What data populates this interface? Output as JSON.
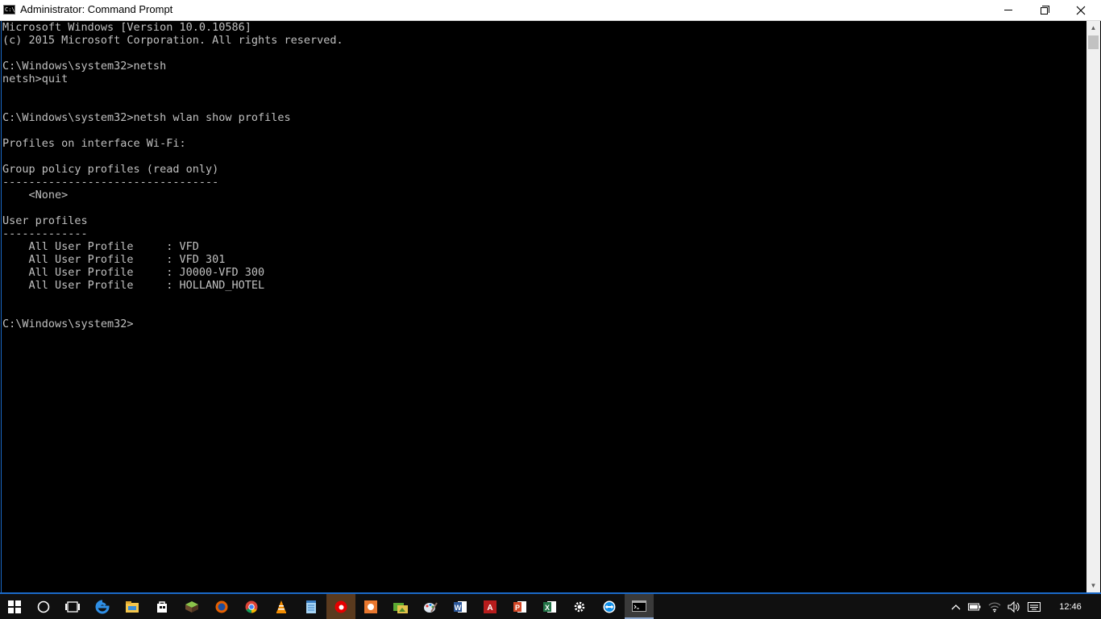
{
  "window": {
    "title": "Administrator: Command Prompt",
    "icon_label": "C:\\"
  },
  "console_lines": [
    "Microsoft Windows [Version 10.0.10586]",
    "(c) 2015 Microsoft Corporation. All rights reserved.",
    "",
    "C:\\Windows\\system32>netsh",
    "netsh>quit",
    "",
    "",
    "C:\\Windows\\system32>netsh wlan show profiles",
    "",
    "Profiles on interface Wi-Fi:",
    "",
    "Group policy profiles (read only)",
    "---------------------------------",
    "    <None>",
    "",
    "User profiles",
    "-------------",
    "    All User Profile     : VFD",
    "    All User Profile     : VFD 301",
    "    All User Profile     : J0000-VFD 300",
    "    All User Profile     : HOLLAND_HOTEL",
    "",
    "",
    "C:\\Windows\\system32>"
  ],
  "taskbar": {
    "pinned": [
      "start-icon",
      "cortana-icon",
      "task-view-icon",
      "edge-icon",
      "file-explorer-icon",
      "store-icon",
      "minecraft-icon",
      "firefox-icon",
      "chrome-icon",
      "vlc-icon",
      "notepad-icon",
      "vodafone-icon",
      "paint-app-icon",
      "photos-icon",
      "paint-icon",
      "word-icon",
      "acrobat-icon",
      "powerpoint-icon",
      "excel-icon",
      "settings-icon",
      "teamviewer-icon",
      "command-prompt-icon"
    ],
    "clock": "12:46"
  },
  "colors": {
    "console_bg": "#000000",
    "console_text": "#c0c0c0",
    "accent": "#1b6ac9",
    "taskbar": "#101010"
  }
}
